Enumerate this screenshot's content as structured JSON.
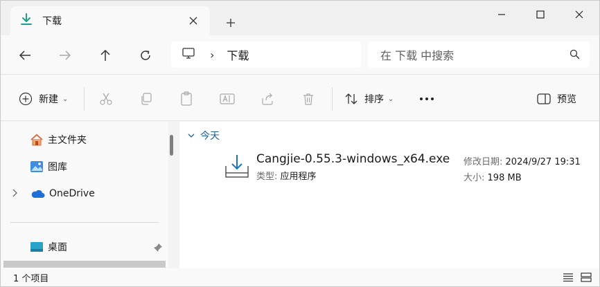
{
  "tab": {
    "title": "下载"
  },
  "address": {
    "path": "下载"
  },
  "search": {
    "placeholder": "在 下载 中搜索"
  },
  "toolbar": {
    "new_label": "新建",
    "sort_label": "排序",
    "preview_label": "预览"
  },
  "sidebar": {
    "items": [
      {
        "label": "主文件夹"
      },
      {
        "label": "图库"
      },
      {
        "label": "OneDrive"
      },
      {
        "label": "桌面"
      }
    ]
  },
  "content": {
    "group": "今天",
    "file": {
      "name": "Cangjie-0.55.3-windows_x64.exe",
      "type_label": "类型:",
      "type_value": "应用程序",
      "date_label": "修改日期:",
      "date_value": "2024/9/27 19:31",
      "size_label": "大小:",
      "size_value": "198 MB"
    }
  },
  "status": {
    "count": "1 个项目"
  },
  "colors": {
    "accent": "#1f9d8a",
    "link": "#1f5f99",
    "onedrive": "#1e6fd9"
  }
}
